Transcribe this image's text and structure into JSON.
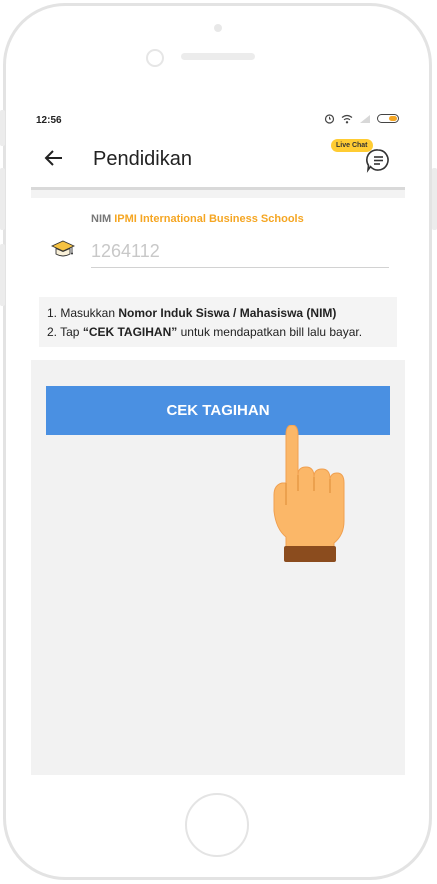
{
  "status_bar": {
    "time": "12:56"
  },
  "header": {
    "title": "Pendidikan",
    "live_chat_badge": "Live Chat"
  },
  "nim_field": {
    "label_prefix": "NIM",
    "school_name": "IPMI International Business Schools",
    "value": "1264112"
  },
  "instructions": {
    "line1_prefix": "1. Masukkan ",
    "line1_bold": "Nomor Induk Siswa / Mahasiswa (NIM)",
    "line2_prefix": "2. Tap ",
    "line2_bold": "“CEK TAGIHAN”",
    "line2_suffix": " untuk mendapatkan bill lalu bayar."
  },
  "action_button": {
    "label": "CEK TAGIHAN"
  },
  "colors": {
    "accent_blue": "#4a90e2",
    "accent_orange": "#f5a623",
    "live_chat_yellow": "#ffcc33"
  },
  "icons": [
    "back-arrow-icon",
    "chat-icon",
    "graduation-cap-icon",
    "alarm-icon",
    "wifi-icon",
    "signal-icon",
    "battery-icon",
    "pointing-hand-icon"
  ]
}
